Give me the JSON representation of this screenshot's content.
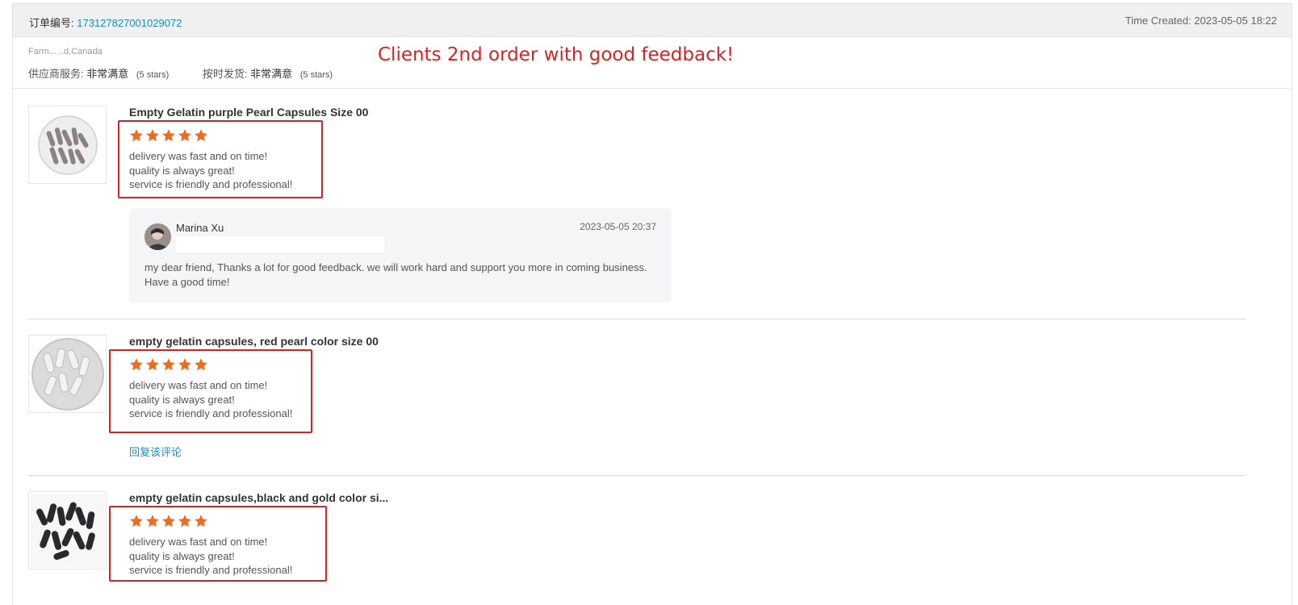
{
  "order": {
    "number_label": "订单编号:",
    "number": "173127827001029072",
    "time_created": "Time Created: 2023-05-05 18:22"
  },
  "buyer": {
    "address": "Farm...  ..d,Canada",
    "supplier_service_label": "供应商服务:",
    "supplier_service_value": "非常满意",
    "supplier_service_stars": "(5 stars)",
    "ontime_label": "按时发货:",
    "ontime_value": "非常满意",
    "ontime_stars": "(5 stars)"
  },
  "annotation": "Clients 2nd order with good feedback!",
  "colors": {
    "star": "#f06b1f",
    "highlight": "#d9221f",
    "link": "#1a8cc6",
    "annotation": "#e02020"
  },
  "reviews": [
    {
      "title": "Empty Gelatin purple Pearl Capsules Size 00",
      "stars": 5,
      "lines": [
        "delivery was fast and on time!",
        "quality is always great!",
        "service is friendly and professional!"
      ],
      "reply": {
        "name": "Marina Xu",
        "date": "2023-05-05 20:37",
        "text": "my dear friend, Thanks a lot for good feedback. we will work hard and support you more in coming business. Have a good time!"
      }
    },
    {
      "title": "empty gelatin capsules, red pearl color size 00",
      "stars": 5,
      "lines": [
        "delivery was fast and on time!",
        "quality is always great!",
        "service is friendly and professional!"
      ],
      "reply_link": "回复该评论"
    },
    {
      "title": "empty gelatin capsules,black and gold color si...",
      "stars": 5,
      "lines": [
        "delivery was fast and on time!",
        "quality is always great!",
        "service is friendly and professional!"
      ]
    }
  ]
}
